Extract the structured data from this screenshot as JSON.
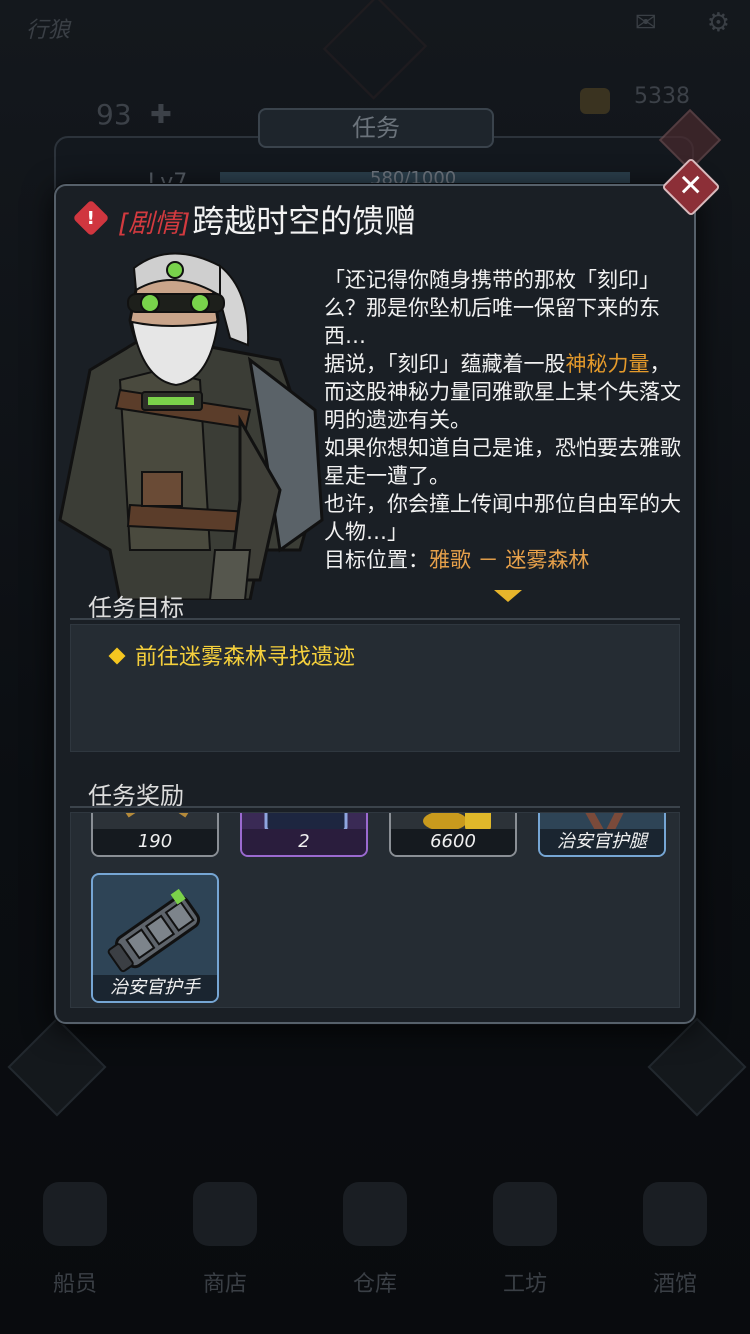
{
  "background": {
    "top_title": "行狼",
    "stat_left": "93",
    "stat_right": "5338",
    "window_title": "任务",
    "level": "Lv7",
    "exp_text": "580/1000",
    "nav": [
      "船员",
      "商店",
      "仓库",
      "工坊",
      "酒馆"
    ]
  },
  "dialog": {
    "close_symbol": "✕",
    "alert_symbol": "!",
    "tag": "[剧情]",
    "title": "跨越时空的馈赠",
    "story": {
      "p1": "「还记得你随身携带的那枚「刻印」么？那是你坠机后唯一保留下来的东西…",
      "p2_before": "据说，「刻印」蕴藏着一股",
      "p2_highlight": "神秘力量",
      "p2_after": "，而这股神秘力量同雅歌星上某个失落文明的遗迹有关。",
      "p3": "如果你想知道自己是谁，恐怕要去雅歌星走一遭了。",
      "p4": "也许，你会撞上传闻中那位自由军的大人物…」",
      "target_label": "目标位置：",
      "target_value": "雅歌 － 迷雾森林"
    },
    "objective_header": "任务目标",
    "objectives": [
      "前往迷雾森林寻找遗迹"
    ],
    "reward_header": "任务奖励",
    "rewards": [
      {
        "label": "190",
        "rarity": "gray",
        "icon": "medal-icon"
      },
      {
        "label": "2",
        "rarity": "purple",
        "icon": "chest-icon"
      },
      {
        "label": "6600",
        "rarity": "gray",
        "icon": "coin-stack-icon"
      },
      {
        "label": "治安官护腿",
        "rarity": "blue",
        "icon": "leg-armor-icon"
      },
      {
        "label": "治安官护手",
        "rarity": "blue",
        "icon": "gauntlet-icon"
      }
    ]
  },
  "colors": {
    "title_tag": "#d23a3f",
    "highlight": "#e49a2b",
    "objective": "#f5d03c",
    "close": "#8c2f37"
  }
}
